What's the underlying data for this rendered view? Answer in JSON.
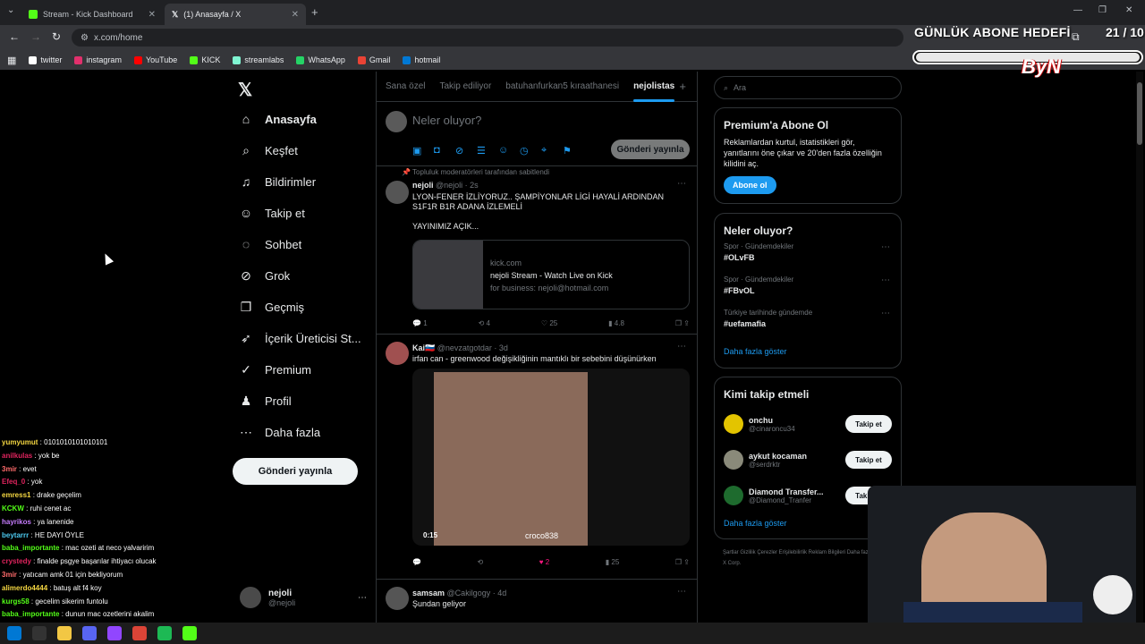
{
  "browser": {
    "tabs": [
      {
        "title": "Stream - Kick Dashboard",
        "icon": "kick-icon",
        "color": "#53fc18"
      },
      {
        "title": "(1) Anasayfa / X",
        "icon": "x-icon",
        "color": "#e7e9ea"
      }
    ],
    "url": "x.com/home",
    "bookmarks": [
      {
        "label": "twitter",
        "color": "#ffffff"
      },
      {
        "label": "instagram",
        "color": "#e1306c"
      },
      {
        "label": "YouTube",
        "color": "#ff0000"
      },
      {
        "label": "KICK",
        "color": "#53fc18"
      },
      {
        "label": "streamlabs",
        "color": "#80f5d2"
      },
      {
        "label": "WhatsApp",
        "color": "#25d366"
      },
      {
        "label": "Gmail",
        "color": "#ea4335"
      },
      {
        "label": "hotmail",
        "color": "#0078d4"
      }
    ]
  },
  "overlay": {
    "title": "GÜNLÜK ABONE HEDEFİ",
    "count": "21 / 10",
    "progress": 1.0,
    "logo": "ByN"
  },
  "sidebar": {
    "items": [
      {
        "label": "Anasayfa",
        "icon": "home-icon",
        "glyph": "⌂"
      },
      {
        "label": "Keşfet",
        "icon": "search-icon",
        "glyph": "⌕"
      },
      {
        "label": "Bildirimler",
        "icon": "bell-icon",
        "glyph": "♫"
      },
      {
        "label": "Takip et",
        "icon": "add-user-icon",
        "glyph": "☺"
      },
      {
        "label": "Sohbet",
        "icon": "chat-icon",
        "glyph": "◌"
      },
      {
        "label": "Grok",
        "icon": "grok-icon",
        "glyph": "⊘"
      },
      {
        "label": "Geçmiş",
        "icon": "bookmark-icon",
        "glyph": "❐"
      },
      {
        "label": "İçerik Üreticisi St...",
        "icon": "rocket-icon",
        "glyph": "➶"
      },
      {
        "label": "Premium",
        "icon": "verified-icon",
        "glyph": "✓"
      },
      {
        "label": "Profil",
        "icon": "profile-icon",
        "glyph": "♟"
      },
      {
        "label": "Daha fazla",
        "icon": "more-icon",
        "glyph": "⋯"
      }
    ],
    "post_label": "Gönderi yayınla",
    "profile_name": "nejoli",
    "profile_handle": "@nejoli"
  },
  "feed": {
    "tabs": [
      "Sana özel",
      "Takip ediliyor",
      "batuhanfurkan5 kıraathanesi",
      "nejolistas"
    ],
    "compose_placeholder": "Neler oluyor?",
    "compose_button": "Gönderi yayınla",
    "tweets": [
      {
        "pinned": "Topluluk moderatörleri tarafından sabitlendi",
        "name": "nejoli",
        "meta": "@nejoli · 2s",
        "lines": [
          "LYON-FENER İZLİYORUZ.. ŞAMPİYONLAR LİGİ HAYALİ ARDINDAN",
          "S1F1R B1R ADANA İZLEMELİ",
          "",
          "YAYINIMIZ AÇIK..."
        ],
        "card": {
          "domain": "kick.com",
          "title": "nejoli Stream - Watch Live on Kick",
          "desc": "for business: nejoli@hotmail.com"
        },
        "stats": {
          "replies": "1",
          "reposts": "4",
          "likes": "25",
          "views": "4.8"
        }
      },
      {
        "name": "Kai🇸🇮",
        "meta": "@nevzatgotdar · 3d",
        "lines": [
          "irfan can - greenwood değişikliğinin mantıklı bir sebebini düşünürken"
        ],
        "video": {
          "time": "0:15",
          "watermark": "croco838"
        },
        "stats": {
          "replies": "",
          "reposts": "",
          "likes": "2",
          "views": "25"
        }
      },
      {
        "name": "samsam",
        "meta": "@Cakilgogy · 4d",
        "lines": [
          "Şundan geliyor"
        ]
      }
    ]
  },
  "right": {
    "search_placeholder": "Ara",
    "premium": {
      "title": "Premium'a Abone Ol",
      "text": "Reklamlardan kurtul, istatistikleri gör, yanıtlarını öne çıkar ve 20'den fazla özelliğin kilidini aç.",
      "button": "Abone ol"
    },
    "trends": {
      "title": "Neler oluyor?",
      "items": [
        {
          "category": "Spor · Gündemdekiler",
          "name": "#OLvFB"
        },
        {
          "category": "Spor · Gündemdekiler",
          "name": "#FBvOL"
        },
        {
          "category": "Türkiye tarihinde gündemde",
          "name": "#uefamafia"
        }
      ],
      "more": "Daha fazla göster"
    },
    "who_to_follow": {
      "title": "Kimi takip etmeli",
      "items": [
        {
          "name": "onchu",
          "handle": "@cinaroncu34",
          "button": "Takip et",
          "color": "#e3c400"
        },
        {
          "name": "aykut kocaman",
          "handle": "@serdrktr",
          "button": "Takip et",
          "color": "#8a8a7a"
        },
        {
          "name": "Diamond Transfer...",
          "handle": "@Diamond_Tranfer",
          "button": "Takip et",
          "color": "#1e6b2e"
        }
      ],
      "more": "Daha fazla göster"
    },
    "footer": "Şartlar   Gizlilik   Çerezler   Erişilebilirlik   Reklam Bilgileri   Daha fazla ···   © 2026 X Corp."
  },
  "chat": [
    {
      "user": "yumyumut",
      "msg": "0101010101010101",
      "color": "#f5d742"
    },
    {
      "user": "anilkulas",
      "msg": "yok be",
      "color": "#e0245e"
    },
    {
      "user": "3mir",
      "msg": "evet",
      "color": "#ff6b6b"
    },
    {
      "user": "Efeq_0",
      "msg": "yok",
      "color": "#e0245e"
    },
    {
      "user": "emress1",
      "msg": "drake geçelim",
      "color": "#f5d742"
    },
    {
      "user": "KCKW",
      "msg": "ruhi cenet ac",
      "color": "#53fc18"
    },
    {
      "user": "hayrikos",
      "msg": "ya lanenide",
      "color": "#c77dff"
    },
    {
      "user": "beytarrr",
      "msg": "HE DAYI ÖYLE",
      "color": "#4cc9f0"
    },
    {
      "user": "baba_importante",
      "msg": "mac ozeti at neco yalvaririm",
      "color": "#53fc18"
    },
    {
      "user": "crystedy",
      "msg": "finalde psgye başarılar ihtiyacı olucak",
      "color": "#e0245e"
    },
    {
      "user": "3mir",
      "msg": "yatıcam amk 01 için bekliyorum",
      "color": "#ff6b6b"
    },
    {
      "user": "alimerdo4444",
      "msg": "batuş alt f4 koy",
      "color": "#f5d742"
    },
    {
      "user": "kurgs58",
      "msg": "gecelim sikerim funtolu",
      "color": "#53fc18"
    },
    {
      "user": "baba_importante",
      "msg": "dunun mac ozetlerini akalim",
      "color": "#53fc18"
    }
  ]
}
